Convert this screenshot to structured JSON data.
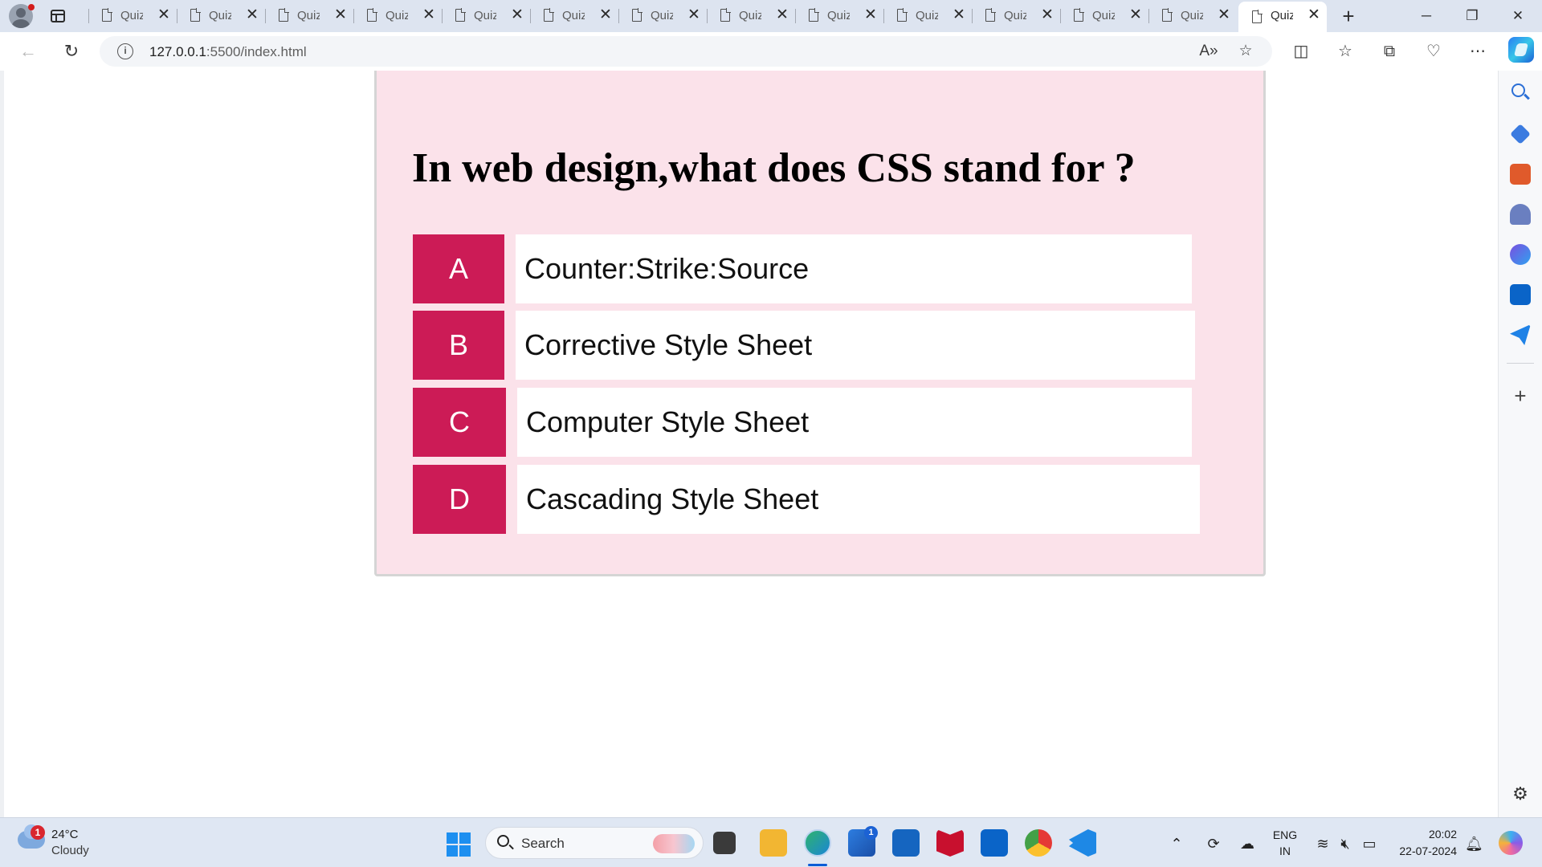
{
  "browser": {
    "tabs": [
      {
        "label": "Quiz"
      },
      {
        "label": "Quiz"
      },
      {
        "label": "Quiz"
      },
      {
        "label": "Quiz"
      },
      {
        "label": "Quiz"
      },
      {
        "label": "Quiz"
      },
      {
        "label": "Quiz"
      },
      {
        "label": "Quiz"
      },
      {
        "label": "Quiz"
      },
      {
        "label": "Quiz"
      },
      {
        "label": "Quiz"
      },
      {
        "label": "Quiz"
      },
      {
        "label": "Quiz"
      },
      {
        "label": "Quiz"
      }
    ],
    "active_tab_index": 13,
    "close_glyph": "✕",
    "new_tab_glyph": "+",
    "url_host": "127.0.0.1",
    "url_path": ":5500/index.html",
    "window_controls": {
      "minimize": "─",
      "restore": "❐",
      "close": "✕"
    }
  },
  "quiz": {
    "question": "In web design,what does CSS stand for ?",
    "options": [
      {
        "letter": "A",
        "text": "Counter:Strike:Source"
      },
      {
        "letter": "B",
        "text": "Corrective Style Sheet"
      },
      {
        "letter": "C",
        "text": "Computer Style Sheet"
      },
      {
        "letter": "D",
        "text": "Cascading Style Sheet"
      }
    ],
    "colors": {
      "card_bg": "#fbe2ea",
      "letter_bg": "#cc1b56",
      "option_bg": "#ffffff"
    }
  },
  "taskbar": {
    "weather": {
      "temp": "24°C",
      "condition": "Cloudy",
      "badge": "1"
    },
    "search_label": "Search",
    "store_badge": "1",
    "language": {
      "line1": "ENG",
      "line2": "IN"
    },
    "clock": {
      "time": "20:02",
      "date": "22-07-2024"
    }
  }
}
